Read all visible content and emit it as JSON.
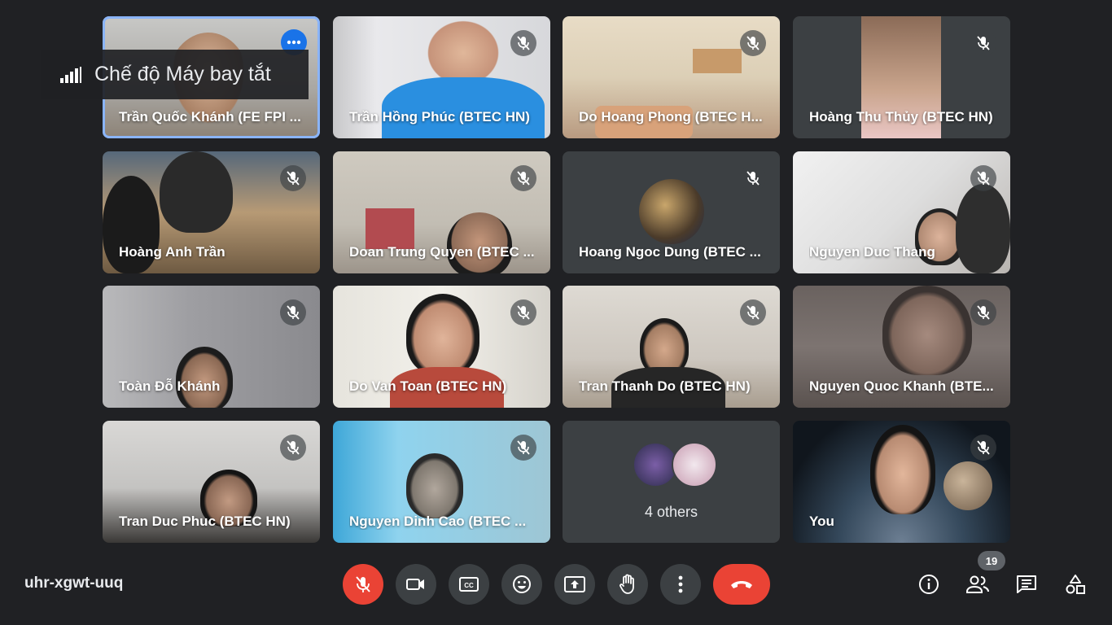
{
  "notification": {
    "text": "Chế độ Máy bay tắt",
    "icon": "signal-bars-icon"
  },
  "participants": [
    {
      "name": "Trần Quốc Khánh (FE FPI ...",
      "muted": false,
      "active": true
    },
    {
      "name": "Trần Hồng Phúc (BTEC HN)",
      "muted": true
    },
    {
      "name": "Do Hoang Phong (BTEC H...",
      "muted": true
    },
    {
      "name": "Hoàng Thu Thủy (BTEC HN)",
      "muted": true
    },
    {
      "name": "Hoàng Anh Trần",
      "muted": true
    },
    {
      "name": "Doan Trung Quyen (BTEC ...",
      "muted": true
    },
    {
      "name": "Hoang Ngoc Dung (BTEC ...",
      "muted": true
    },
    {
      "name": "Nguyen Duc Thang",
      "muted": true
    },
    {
      "name": "Toàn Đỗ Khánh",
      "muted": true
    },
    {
      "name": "Do Van Toan (BTEC HN)",
      "muted": true
    },
    {
      "name": "Tran Thanh Do (BTEC HN)",
      "muted": true
    },
    {
      "name": "Nguyen Quoc Khanh (BTE...",
      "muted": true
    },
    {
      "name": "Tran Duc Phuc (BTEC HN)",
      "muted": true
    },
    {
      "name": "Nguyen Dinh Cao (BTEC ...",
      "muted": true
    },
    {
      "name": "4 others",
      "muted": false
    },
    {
      "name": "You",
      "muted": true
    }
  ],
  "meeting": {
    "code": "uhr-xgwt-uuq",
    "participant_count": "19"
  },
  "controls": [
    {
      "name": "mic-off-icon"
    },
    {
      "name": "camera-icon"
    },
    {
      "name": "captions-icon"
    },
    {
      "name": "emoji-icon"
    },
    {
      "name": "present-icon"
    },
    {
      "name": "raise-hand-icon"
    },
    {
      "name": "more-options-icon"
    },
    {
      "name": "leave-call-icon"
    }
  ],
  "side_controls": [
    {
      "name": "info-icon"
    },
    {
      "name": "people-icon"
    },
    {
      "name": "chat-icon"
    },
    {
      "name": "activities-icon"
    }
  ],
  "colors": {
    "background": "#202124",
    "tile": "#3c4043",
    "accent": "#8ab4f8",
    "danger": "#ea4335"
  }
}
